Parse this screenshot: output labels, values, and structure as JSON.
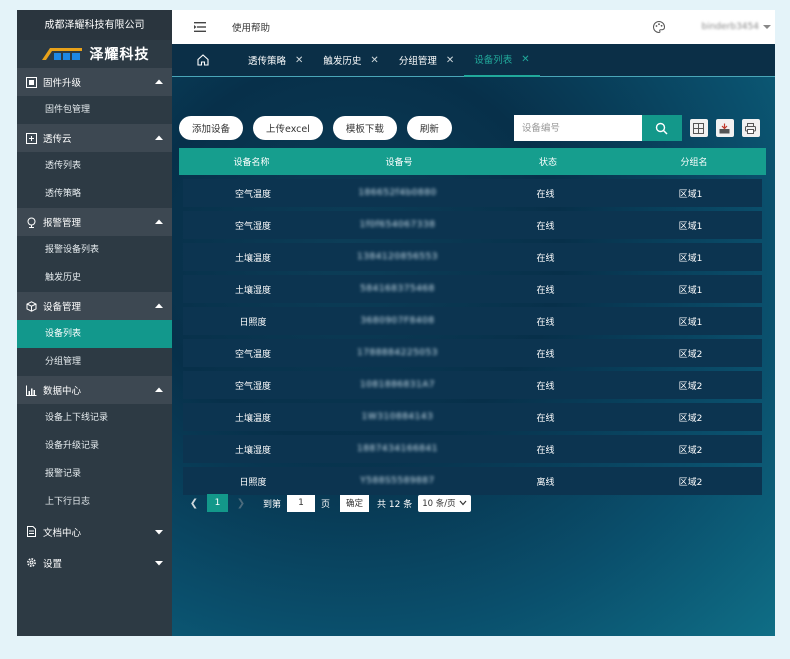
{
  "sidebar": {
    "company": "成都泽耀科技有限公司",
    "brand": "泽耀科技",
    "groups": [
      {
        "label": "固件升级",
        "icon": "firmware-icon",
        "items": [
          "固件包管理"
        ]
      },
      {
        "label": "透传云",
        "icon": "cloud-icon",
        "items": [
          "透传列表",
          "透传策略"
        ]
      },
      {
        "label": "报警管理",
        "icon": "alarm-icon",
        "items": [
          "报警设备列表",
          "触发历史"
        ]
      },
      {
        "label": "设备管理",
        "icon": "device-icon",
        "items": [
          "设备列表",
          "分组管理"
        ]
      },
      {
        "label": "数据中心",
        "icon": "chart-icon",
        "items": [
          "设备上下线记录",
          "设备升级记录",
          "报警记录",
          "上下行日志"
        ]
      },
      {
        "label": "文档中心",
        "icon": "document-icon",
        "items": []
      },
      {
        "label": "设置",
        "icon": "gear-icon",
        "items": []
      }
    ]
  },
  "header": {
    "help": "使用帮助",
    "user": "binderb3454"
  },
  "tabs": [
    "透传策略",
    "触发历史",
    "分组管理",
    "设备列表"
  ],
  "toolbar": {
    "add": "添加设备",
    "upload": "上传excel",
    "template": "模板下载",
    "refresh": "刷新",
    "search_placeholder": "设备编号"
  },
  "table": {
    "headers": [
      "设备名称",
      "设备号",
      "状态",
      "分组名"
    ],
    "rows": [
      [
        "空气温度",
        "186652f4b0880",
        "在线",
        "区域1"
      ],
      [
        "空气湿度",
        "1f0f654067338",
        "在线",
        "区域1"
      ],
      [
        "土壤温度",
        "1384120856553",
        "在线",
        "区域1"
      ],
      [
        "土壤湿度",
        "584168375468",
        "在线",
        "区域1"
      ],
      [
        "日照度",
        "3680907F8408",
        "在线",
        "区域1"
      ],
      [
        "空气温度",
        "1788884225053",
        "在线",
        "区域2"
      ],
      [
        "空气湿度",
        "1081886831A7",
        "在线",
        "区域2"
      ],
      [
        "土壤温度",
        "1W310884143",
        "在线",
        "区域2"
      ],
      [
        "土壤湿度",
        "1887434166841",
        "在线",
        "区域2"
      ],
      [
        "日照度",
        "Y588S5589887",
        "离线",
        "区域2"
      ]
    ]
  },
  "pager": {
    "current": "1",
    "goto": "到第",
    "page_value": "1",
    "page_unit": "页",
    "confirm": "确定",
    "total": "共 12 条",
    "size": "10 条/页"
  }
}
